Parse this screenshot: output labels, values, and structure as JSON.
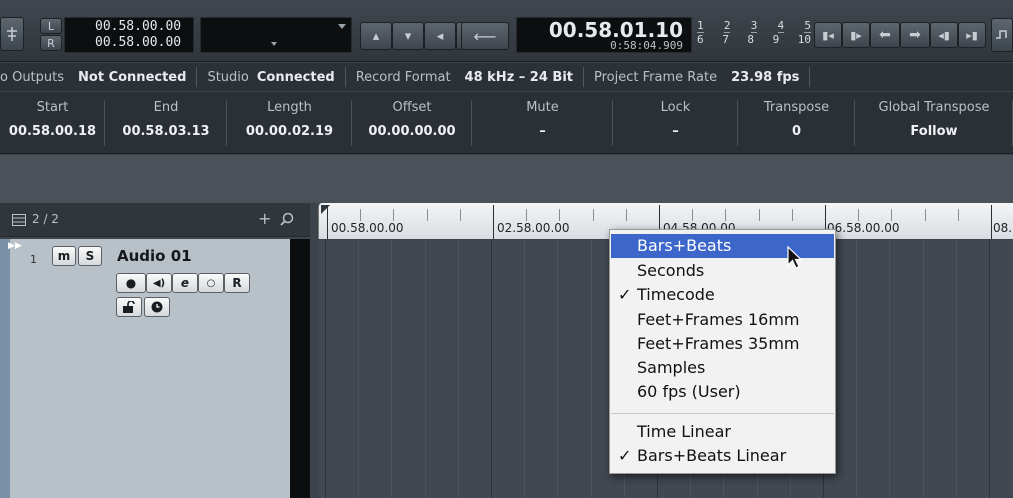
{
  "transport": {
    "locator_left": "00.58.00.00",
    "locator_right": "00.58.00.00",
    "left_label": "L",
    "right_label": "R",
    "timecode_main": "00.58.01.10",
    "timecode_sub": "0:58:04.909",
    "marker_numbers_top": [
      "1",
      "2",
      "3",
      "4",
      "5"
    ],
    "marker_numbers_bottom": [
      "6",
      "7",
      "8",
      "9",
      "10"
    ]
  },
  "status": {
    "outputs_label": "o Outputs",
    "outputs_value": "Not Connected",
    "studio_label": "Studio",
    "studio_value": "Connected",
    "record_format_label": "Record Format",
    "record_format_value": "48 kHz – 24 Bit",
    "frame_rate_label": "Project Frame Rate",
    "frame_rate_value": "23.98 fps"
  },
  "info": {
    "columns": [
      {
        "header": "Start",
        "value": "00.58.00.18"
      },
      {
        "header": "End",
        "value": "00.58.03.13"
      },
      {
        "header": "Length",
        "value": "00.00.02.19"
      },
      {
        "header": "Offset",
        "value": "00.00.00.00"
      },
      {
        "header": "Mute",
        "value": "–"
      },
      {
        "header": "Lock",
        "value": "–"
      },
      {
        "header": "Transpose",
        "value": "0"
      },
      {
        "header": "Global Transpose",
        "value": "Follow"
      }
    ]
  },
  "tracklist": {
    "count": "2 / 2",
    "add": "+",
    "track": {
      "number": "1",
      "name": "Audio 01",
      "mute": "m",
      "solo": "S",
      "read": "R",
      "edit": "e"
    }
  },
  "ruler": {
    "labels": [
      "00.58.00.00",
      "02.58.00.00",
      "04.58.00.00",
      "06.58.00.00",
      "08."
    ]
  },
  "menu": {
    "items": [
      {
        "label": "Bars+Beats",
        "checked": false,
        "highlighted": true
      },
      {
        "label": "Seconds",
        "checked": false,
        "highlighted": false
      },
      {
        "label": "Timecode",
        "checked": true,
        "highlighted": false
      },
      {
        "label": "Feet+Frames 16mm",
        "checked": false,
        "highlighted": false
      },
      {
        "label": "Feet+Frames 35mm",
        "checked": false,
        "highlighted": false
      },
      {
        "label": "Samples",
        "checked": false,
        "highlighted": false
      },
      {
        "label": "60 fps (User)",
        "checked": false,
        "highlighted": false
      },
      {
        "label": "Time Linear",
        "checked": false,
        "highlighted": false
      },
      {
        "label": "Bars+Beats Linear",
        "checked": true,
        "highlighted": false
      }
    ],
    "check_glyph": "✓"
  },
  "colors": {
    "menu_highlight": "#3c66c9",
    "track_strip": "#7891a6"
  }
}
